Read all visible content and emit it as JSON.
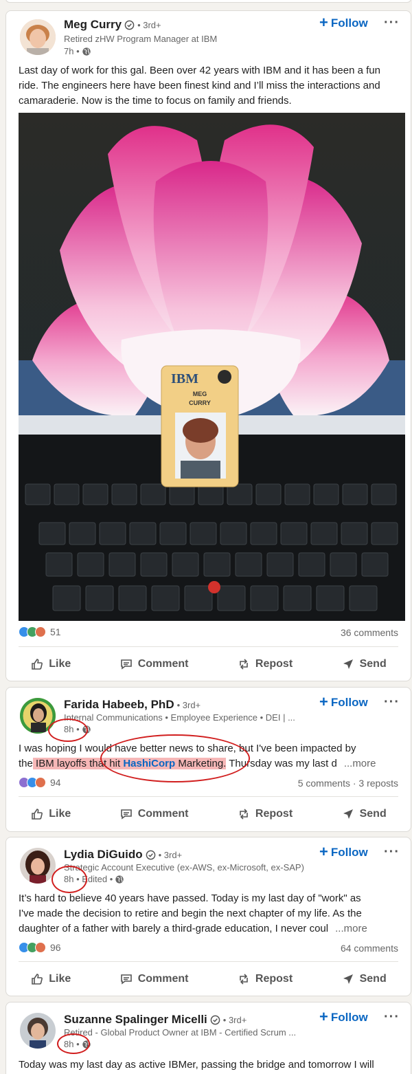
{
  "posts": [
    {
      "name": "Meg Curry",
      "degree": "• 3rd+",
      "headline": "Retired zHW Program Manager at IBM",
      "time": "7h •",
      "follow_label": "Follow",
      "text": "Last day of work for this gal. Been over 42 years with IBM and it has been a fun ride. The engineers here have been finest kind and I’ll miss the interactions and camaraderie. Now is the time to focus on family and friends.",
      "badge_logo": "IBM",
      "badge_name_1": "MEG",
      "badge_name_2": "CURRY",
      "reaction_count": "51",
      "comments": "36 comments"
    },
    {
      "name": "Farida Habeeb, PhD",
      "degree": "• 3rd+",
      "headline": "Internal Communications • Employee Experience • DEI | ...",
      "time": "8h •",
      "follow_label": "Follow",
      "text_1": "I was hoping I would have better news to share, but I've been impacted by",
      "text_2a": "the",
      "text_2b": " IBM layoffs that hit ",
      "text_2c": "HashiCorp",
      "text_2d": " Marketing.",
      "text_2e": " Thursday was my last d",
      "more_label": "...more",
      "reaction_count": "94",
      "comments": "5 comments · 3 reposts"
    },
    {
      "name": "Lydia DiGuido",
      "degree": "• 3rd+",
      "headline": "Strategic Account Executive (ex-AWS, ex-Microsoft, ex-SAP)",
      "time": "8h • Edited •",
      "follow_label": "Follow",
      "text_1": "It’s hard to believe 40 years have passed. Today is my last day of \"work\" as",
      "text_2": "I've made the decision to retire and begin the next chapter of my life. As the",
      "text_3": "daughter of a father with barely a third-grade education, I never coul",
      "more_label": "...more",
      "reaction_count": "96",
      "comments": "64 comments"
    },
    {
      "name": "Suzanne Spalinger Micelli",
      "degree": "• 3rd+",
      "headline": "Retired - Global Product Owner at IBM - Certified Scrum ...",
      "time": "8h •",
      "follow_label": "Follow",
      "text_1": "Today was my last day as active IBMer, passing the bridge and tomorrow I will"
    }
  ],
  "actions": {
    "like": "Like",
    "comment": "Comment",
    "repost": "Repost",
    "send": "Send"
  },
  "colors": {
    "brand": "#0a66c2",
    "annotation": "#d11e1e",
    "highlight": "#f6b7b7"
  }
}
